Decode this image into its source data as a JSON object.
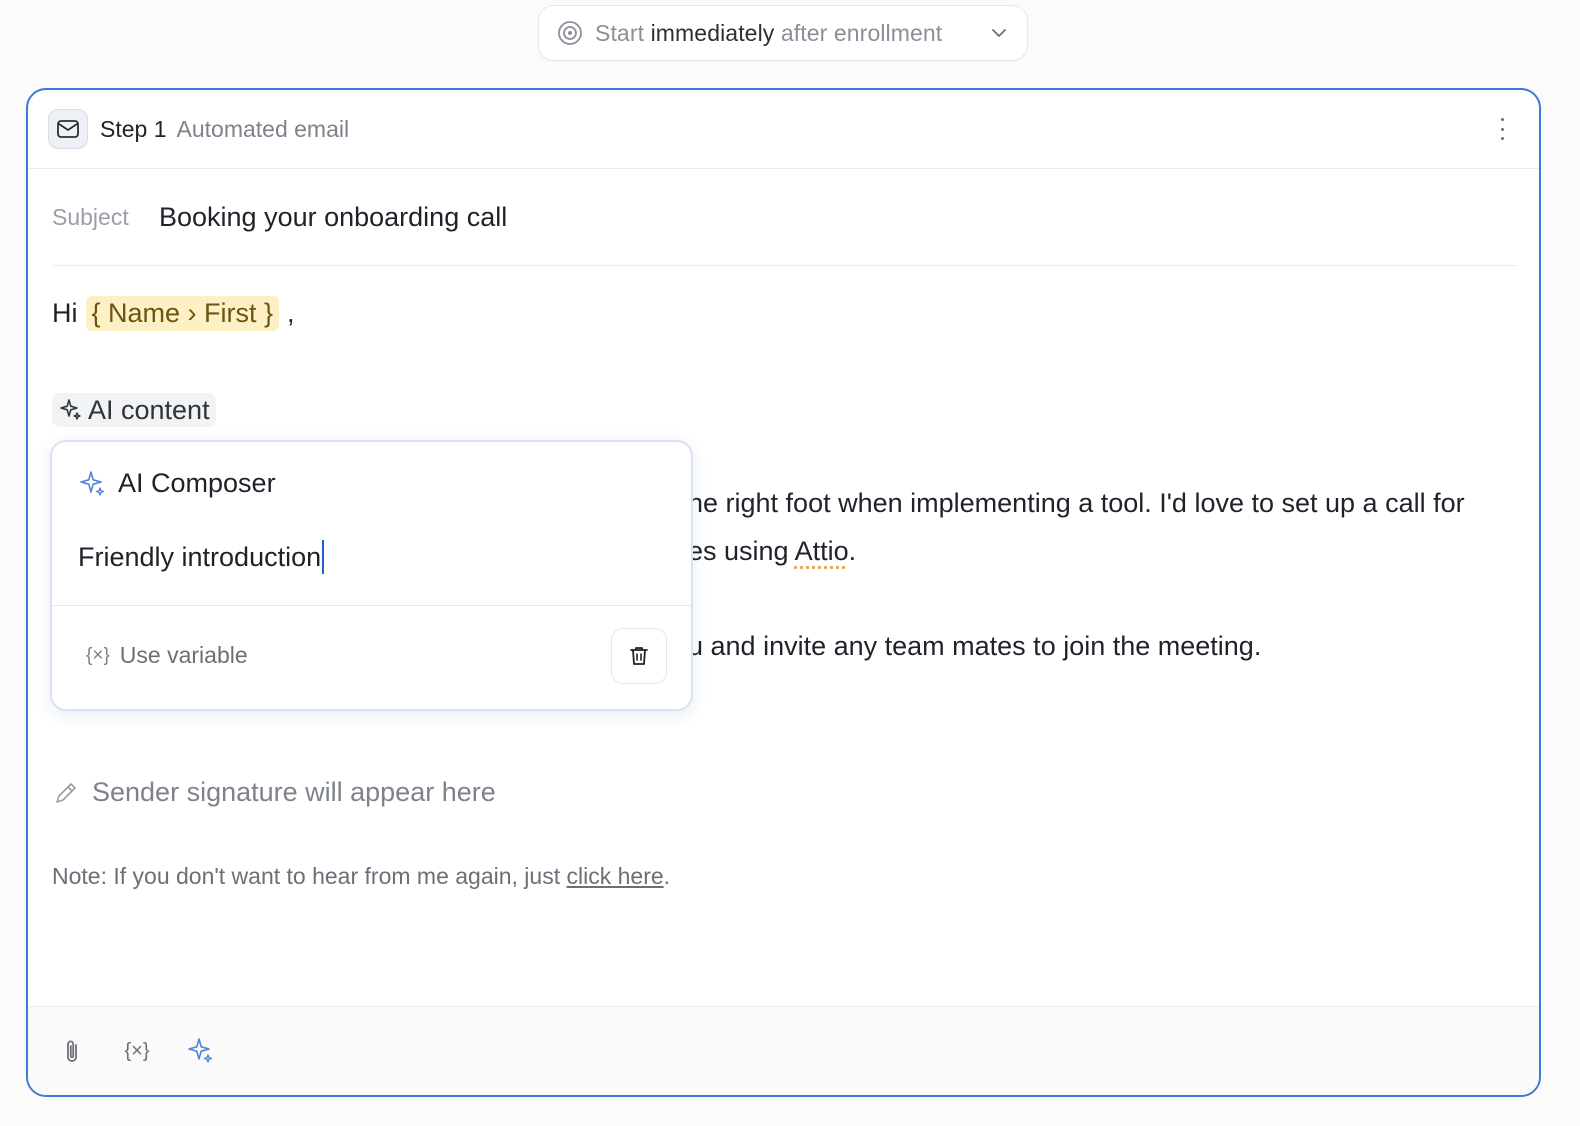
{
  "trigger": {
    "prefix": "Start",
    "emphasis": "immediately",
    "suffix": "after enrollment",
    "icon": "target-icon",
    "chevron_icon": "chevron-down-icon"
  },
  "step": {
    "title": "Step 1",
    "subtitle": "Automated email",
    "icon": "mail-icon",
    "menu_icon": "more-vertical-icon"
  },
  "email": {
    "subject_label": "Subject",
    "subject_value": "Booking your onboarding call",
    "greeting": "Hi",
    "greeting_variable": "{ Name › First }",
    "greeting_comma": ",",
    "ai_chip_label": "AI content",
    "body_line_1": "he right foot when implementing a tool. I'd love to set up a call for",
    "body_line_2_pre": "es using ",
    "body_line_2_word": "Attio",
    "body_line_2_post": ".",
    "body_line_3": "u and invite any team mates to join the meeting.",
    "signature_placeholder": "Sender signature will appear here",
    "note_text": "Note: If you don't want to hear from me again, just ",
    "note_link": "click here",
    "note_end": "."
  },
  "composer": {
    "title": "AI Composer",
    "input_value": "Friendly introduction",
    "use_variable_label": "Use variable",
    "use_variable_icon": "{×}",
    "delete_icon": "trash-icon"
  },
  "toolbar": {
    "attach_icon": "paperclip-icon",
    "variable_icon": "{×}",
    "ai_icon": "sparkle-icon"
  },
  "colors": {
    "accent": "#3b7bd8",
    "variable_bg": "#fdf0c4",
    "variable_text": "#6b5510"
  }
}
